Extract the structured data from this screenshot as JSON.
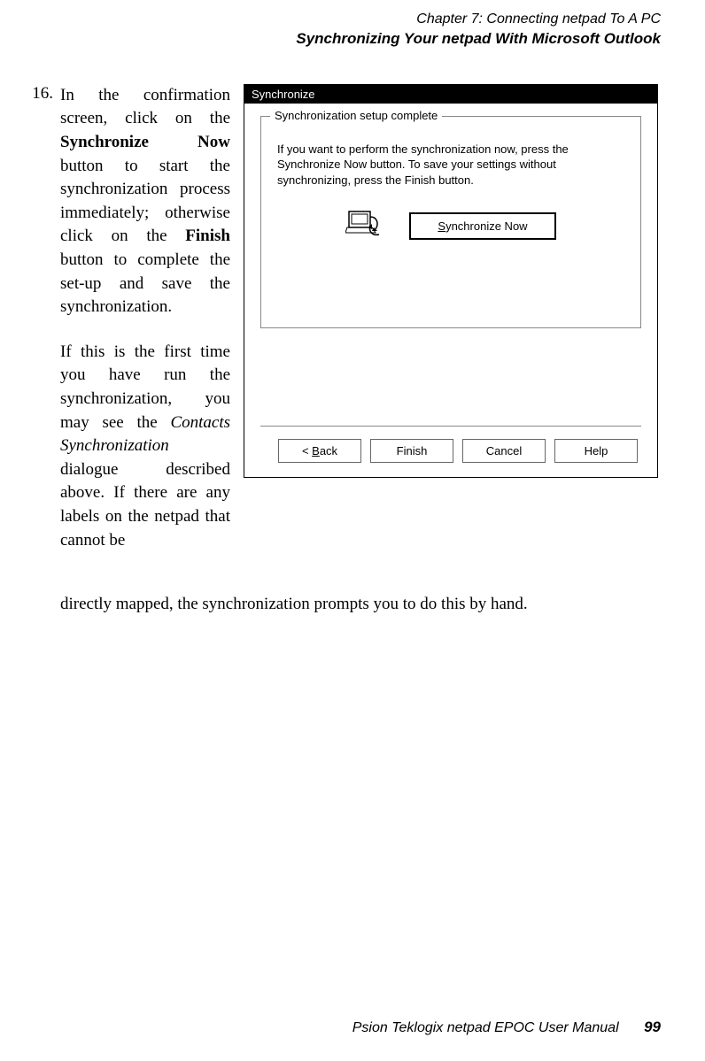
{
  "header": {
    "chapter": "Chapter 7:  Connecting netpad To A PC",
    "section": "Synchronizing Your netpad With Microsoft Outlook"
  },
  "step": {
    "number": "16.",
    "p1_a": "In the confirmation screen, click on the ",
    "p1_b": "Synchronize Now",
    "p1_c": " button to start the synchronization process immediately; otherwise click on the ",
    "p1_d": "Finish",
    "p1_e": " button to complete the set-up and save the synchronization.",
    "p2_a": "If this is the first time you have run the synchronization, you may see the ",
    "p2_b": "Contacts Synchronization",
    "p2_c": " dialogue described above. If there are any labels on the netpad that cannot be",
    "final": "directly mapped, the synchronization prompts you to do this by hand."
  },
  "dialog": {
    "title": "Synchronize",
    "group_legend": "Synchronization setup complete",
    "message": "If you want to perform the synchronization now, press the Synchronize Now button. To save your settings without synchronizing, press the Finish button.",
    "sync_btn_mn": "S",
    "sync_btn_rest": "ynchronize Now",
    "back_lt": "< ",
    "back_mn": "B",
    "back_rest": "ack",
    "finish": "Finish",
    "cancel": "Cancel",
    "help": "Help"
  },
  "footer": {
    "manual": "Psion Teklogix netpad EPOC User Manual",
    "page": "99"
  }
}
